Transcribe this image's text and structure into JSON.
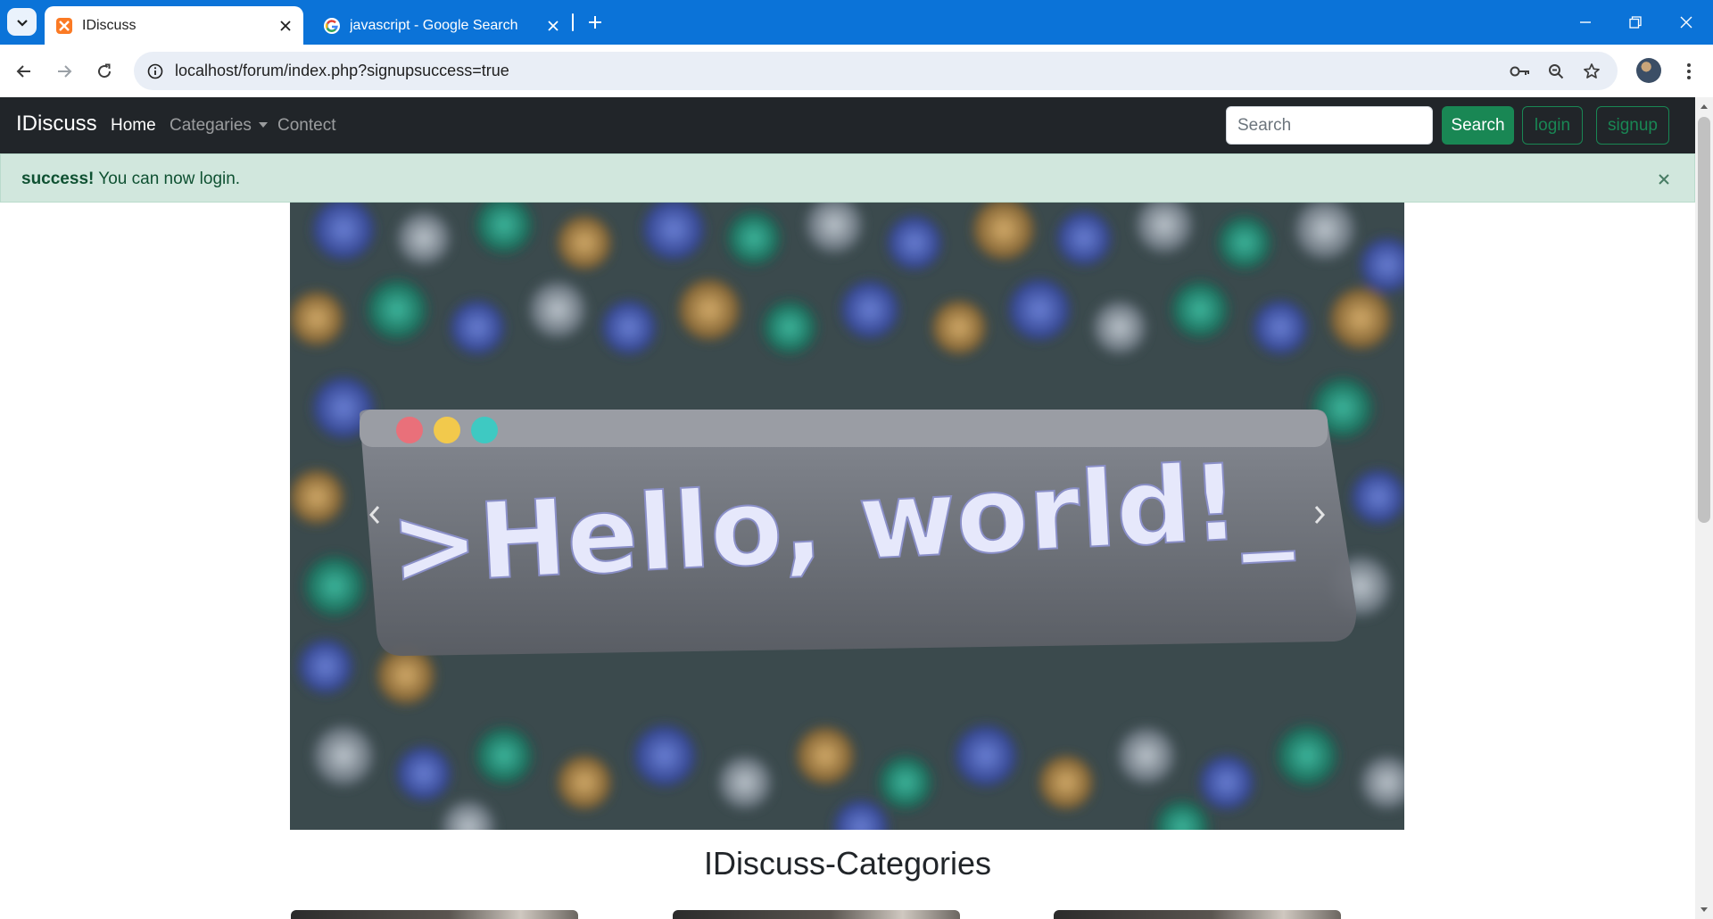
{
  "browser": {
    "tabs": [
      {
        "title": "IDiscuss",
        "active": true,
        "favicon": "xampp-icon"
      },
      {
        "title": "javascript - Google Search",
        "active": false,
        "favicon": "google-icon"
      }
    ],
    "url": "localhost/forum/index.php?signupsuccess=true"
  },
  "navbar": {
    "brand": "IDiscuss",
    "links": [
      {
        "label": "Home",
        "active": true
      },
      {
        "label": "Categaries",
        "dropdown": true
      },
      {
        "label": "Contect"
      }
    ],
    "search_placeholder": "Search",
    "search_button": "Search",
    "login_button": "login",
    "signup_button": "signup"
  },
  "alert": {
    "strong": "success!",
    "message": " You can now login."
  },
  "carousel": {
    "image_text": ">Hello, world!_"
  },
  "categories": {
    "heading": "IDiscuss-Categories"
  },
  "colors": {
    "chrome_blue": "#0b73d8",
    "navbar_bg": "#212529",
    "success": "#198754",
    "alert_bg": "#d1e7dd",
    "alert_text": "#0f5132"
  }
}
